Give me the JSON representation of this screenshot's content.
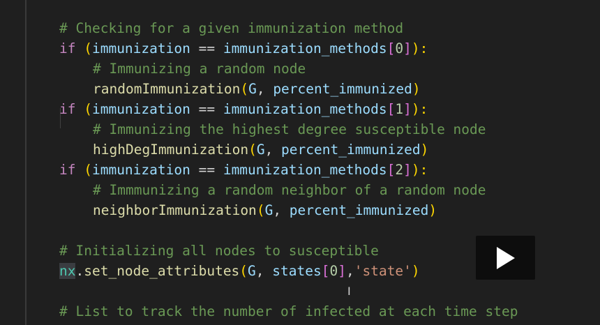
{
  "editor": {
    "lines": {
      "l1": {
        "comment": "# Checking for a given immunization method"
      },
      "l2": {
        "kw": "if",
        "open": " (",
        "v1": "immunization",
        "op": " == ",
        "v2": "immunization_methods",
        "b1": "[",
        "num": "0",
        "b2": "]",
        "close": "):"
      },
      "l3": {
        "comment": "# Immunizing a random node"
      },
      "l4": {
        "fn": "randomImmunization",
        "open": "(",
        "a1": "G",
        "sep": ", ",
        "a2": "percent_immunized",
        "close": ")"
      },
      "l5": {
        "kw": "if",
        "open": " (",
        "v1": "immunization",
        "op": " == ",
        "v2": "immunization_methods",
        "b1": "[",
        "num": "1",
        "b2": "]",
        "close": "):"
      },
      "l6": {
        "comment": "# Immunizing the highest degree susceptible node"
      },
      "l7": {
        "fn": "highDegImmunization",
        "open": "(",
        "a1": "G",
        "sep": ", ",
        "a2": "percent_immunized",
        "close": ")"
      },
      "l8": {
        "kw": "if",
        "open": " (",
        "v1": "immunization",
        "op": " == ",
        "v2": "immunization_methods",
        "b1": "[",
        "num": "2",
        "b2": "]",
        "close": "):"
      },
      "l9": {
        "comment": "# Immmunizing a random neighbor of a random node"
      },
      "l10": {
        "fn": "neighborImmunization",
        "open": "(",
        "a1": "G",
        "sep": ", ",
        "a2": "percent_immunized",
        "close": ")"
      },
      "l11": {
        "comment": "# Initializing all nodes to susceptible"
      },
      "l12": {
        "mod": "nx",
        "dot": ".",
        "fn": "set_node_attributes",
        "open": "(",
        "a1": "G",
        "sep": ", ",
        "a2": "states",
        "b1": "[",
        "num": "0",
        "b2": "]",
        "sep2": ",",
        "str": "'state'",
        "close": ")"
      },
      "l13": {
        "comment": "# List to track the number of infected at each time step"
      }
    }
  },
  "video": {
    "play_icon": "play-icon"
  },
  "cursor": {
    "glyph": "I"
  }
}
